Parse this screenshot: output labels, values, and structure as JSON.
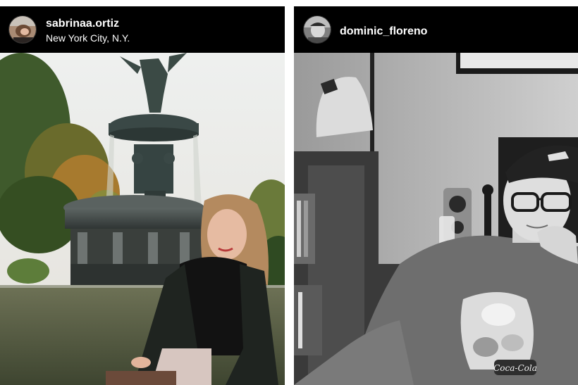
{
  "posts": [
    {
      "username": "sabrinaa.ortiz",
      "location": "New York City, N.Y.",
      "avatar_icon": "profile-avatar-photo",
      "photo_icon": "fountain-portrait-photo"
    },
    {
      "username": "dominic_floreno",
      "avatar_icon": "profile-avatar-photo",
      "photo_icon": "bw-room-portrait-photo",
      "shirt_text": "Coca-Cola"
    }
  ],
  "colors": {
    "header_bg": "#000000",
    "text": "#ffffff",
    "page_bg": "#ffffff"
  }
}
